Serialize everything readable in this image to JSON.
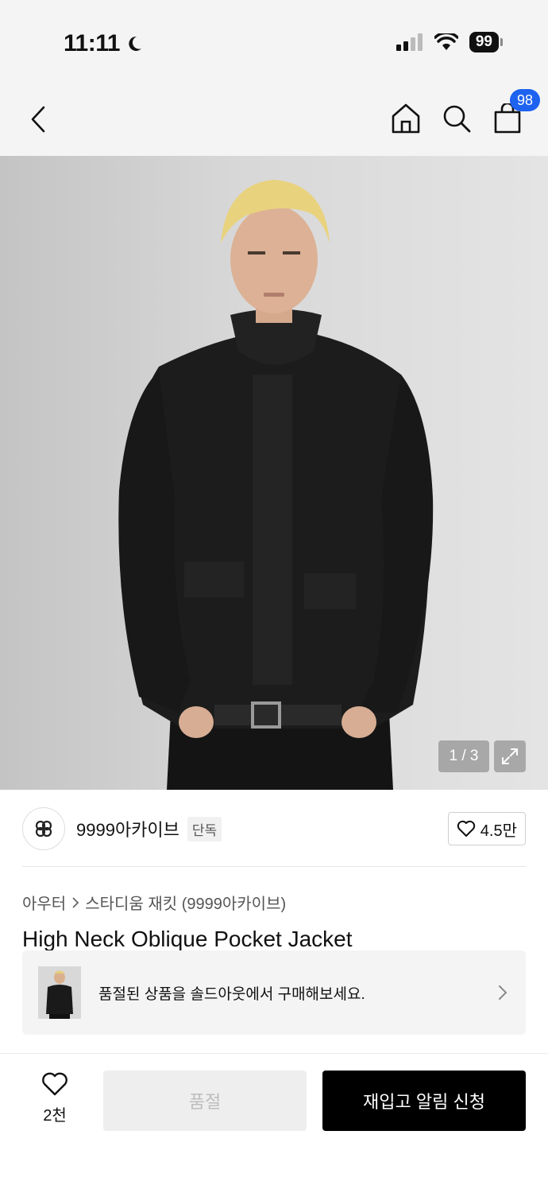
{
  "status_bar": {
    "time": "11:11",
    "battery": "99"
  },
  "nav": {
    "cart_count": "98"
  },
  "gallery": {
    "counter": "1 / 3"
  },
  "brand": {
    "name": "9999아카이브",
    "badge": "단독",
    "likes": "4.5만"
  },
  "breadcrumb": {
    "level1": "아우터",
    "level2": "스타디움 재킷 (9999아카이브)"
  },
  "product": {
    "title": "High Neck Oblique Pocket Jacket"
  },
  "soldout_banner": {
    "text": "품절된 상품을 솔드아웃에서 구매해보세요."
  },
  "bottom_bar": {
    "wish_count": "2천",
    "soldout_label": "품절",
    "restock_label": "재입고 알림 신청"
  },
  "colors": {
    "badge_blue": "#1e62f0",
    "primary_button": "#000000",
    "disabled_button": "#eeeeee"
  }
}
